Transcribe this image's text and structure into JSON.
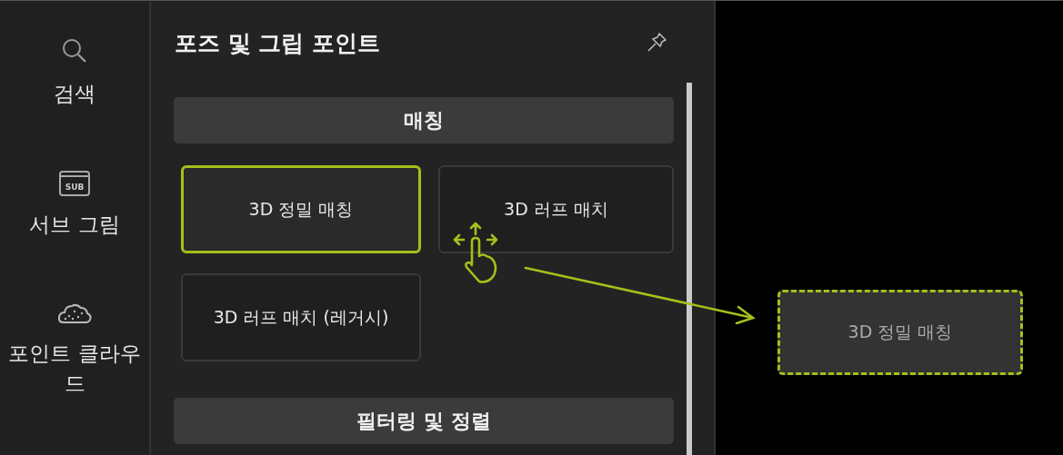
{
  "rail": {
    "items": [
      {
        "kind": "search",
        "label": "검색"
      },
      {
        "kind": "sub",
        "label": "서브 그림",
        "icon_text": "SUB"
      },
      {
        "kind": "cloud",
        "label": "포인트 클라우드"
      }
    ]
  },
  "panel": {
    "title": "포즈 및 그립 포인트",
    "pinned": false,
    "sections": [
      {
        "title": "매칭",
        "items": [
          {
            "label": "3D 정밀 매칭",
            "selected": true
          },
          {
            "label": "3D 러프 매치",
            "selected": false
          },
          {
            "label": "3D 러프 매치 (레거시)",
            "selected": false
          }
        ]
      },
      {
        "title": "필터링 및 정렬"
      }
    ]
  },
  "drag": {
    "label": "3D 정밀 매칭"
  }
}
